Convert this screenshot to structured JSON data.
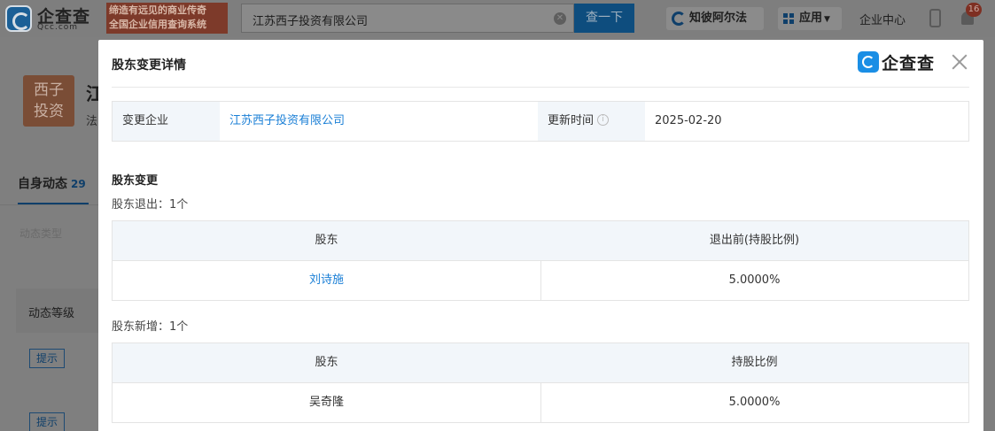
{
  "header": {
    "logo_text": "企查查",
    "logo_sub": "Qcc.com",
    "slogan_line1": "缔造有远见的商业传奇",
    "slogan_line2": "全国企业信用查询系统",
    "search_value": "江苏西子投资有限公司",
    "search_button": "查一下",
    "zhibi_label": "知彼阿尔法",
    "app_label": "应用",
    "enterprise_center": "企业中心",
    "notification_count": "16"
  },
  "background": {
    "company_logo_line1": "西子",
    "company_logo_line2": "投资",
    "company_name_first_char": "江",
    "legal_first_char": "法",
    "tab_label": "自身动态",
    "tab_count": "29",
    "filter_label": "动态类型",
    "level_label": "动态等级",
    "tip_label": "提示"
  },
  "modal": {
    "title": "股东变更详情",
    "brand_text": "企查查",
    "info": {
      "company_label": "变更企业",
      "company_value": "江苏西子投资有限公司",
      "update_label": "更新时间",
      "update_value": "2025-02-20"
    },
    "section_title": "股东变更",
    "exit": {
      "heading": "股东退出：1个",
      "columns": [
        "股东",
        "退出前(持股比例)"
      ],
      "rows": [
        {
          "holder": "刘诗施",
          "ratio": "5.0000%"
        }
      ]
    },
    "add": {
      "heading": "股东新增：1个",
      "columns": [
        "股东",
        "持股比例"
      ],
      "rows": [
        {
          "holder": "吴奇隆",
          "ratio": "5.0000%"
        }
      ]
    }
  },
  "colors": {
    "link": "#1a7fd6",
    "header_bg": "#f2f6fa",
    "brand_blue": "#1a8ee5"
  }
}
